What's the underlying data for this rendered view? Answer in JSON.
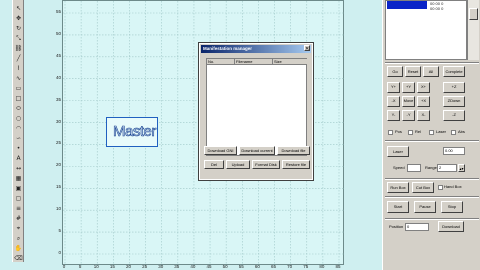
{
  "toolbar": {
    "icons": [
      "pointer-icon",
      "move-icon",
      "rotate-icon",
      "scale-icon",
      "link-icon",
      "line-icon",
      "polyline-icon",
      "curve-icon",
      "rectangle-icon",
      "square-icon",
      "ellipse-icon",
      "circle-icon",
      "arc-icon",
      "spline-icon",
      "node-icon",
      "text-icon",
      "dimension-icon",
      "hatch-icon",
      "group-icon",
      "ungroup-icon",
      "align-icon",
      "grid-icon",
      "snap-icon",
      "zoom-icon",
      "pan-icon",
      "erase-icon"
    ]
  },
  "plot": {
    "y_ticks": [
      "55",
      "50",
      "45",
      "40",
      "35",
      "30",
      "25",
      "20",
      "15",
      "10",
      "5",
      "0"
    ],
    "x_ticks": [
      "0",
      "5",
      "10",
      "15",
      "20",
      "25",
      "30",
      "35",
      "40",
      "45",
      "50",
      "55",
      "60",
      "65",
      "70",
      "75",
      "80",
      "85"
    ]
  },
  "master_label": "Master",
  "dialog": {
    "title": "Manifestation manager",
    "columns": [
      "No.",
      "Filename",
      "Size"
    ],
    "buttons_row1": [
      "Download GNI",
      "Download current",
      "Download file"
    ],
    "buttons_row2": [
      "Del",
      "Upload",
      "Format Disk",
      "Restore file"
    ]
  },
  "right_panel": {
    "list_rows": [
      "00 00 0",
      "00 00 0"
    ],
    "row1_buttons": [
      "Go",
      "Reset",
      "All",
      "Complete"
    ],
    "jog": {
      "up_label": "+Y",
      "left_label": "-X",
      "center_label": "Move",
      "right_label": "+X",
      "down_label": "-Y",
      "z_up": "+Z",
      "z_center": "ZDown",
      "z_down": "-Z",
      "corner_labels": [
        "Y+",
        "X+",
        "Y-",
        "X-"
      ]
    },
    "checks": [
      "Pos",
      "Rel",
      "Laser",
      "Abs"
    ],
    "laser_button": "Laser",
    "laser_field": "0.00",
    "speed_label": "Speed",
    "range_label": "Range",
    "range_value": "2",
    "run_buttons": [
      "Run Box",
      "Cut Box",
      "Hand Box"
    ],
    "start_buttons": [
      "Start",
      "Pause",
      "Stop"
    ],
    "position_label": "Position",
    "position_value": "0",
    "download_button": "Download"
  }
}
